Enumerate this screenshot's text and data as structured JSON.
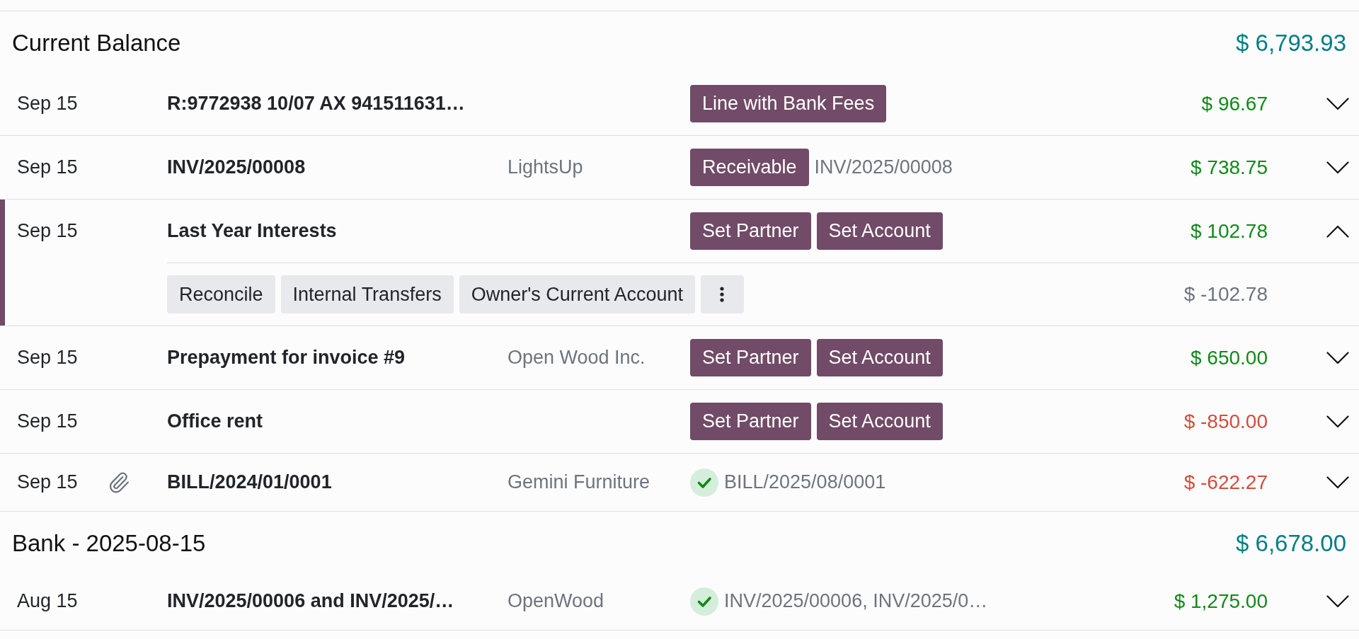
{
  "sections": [
    {
      "title": "Current Balance",
      "balance": "$ 6,793.93",
      "lines": [
        {
          "date": "Sep 15",
          "attachment": false,
          "label": "R:9772938 10/07 AX 941511631…",
          "actions": [
            "Line with Bank Fees"
          ],
          "matched": false,
          "amount": "$ 96.67",
          "color": "#108a17",
          "expanded": false,
          "selected": false
        },
        {
          "date": "Sep 15",
          "attachment": false,
          "label": "INV/2025/00008",
          "partner": "LightsUp",
          "actions": [
            "Receivable"
          ],
          "matched": false,
          "reference": "INV/2025/00008",
          "amount": "$ 738.75",
          "color": "#108a17",
          "expanded": false,
          "selected": false
        },
        {
          "date": "Sep 15",
          "attachment": false,
          "label": "Last Year Interests",
          "actions": [
            "Set Partner",
            "Set Account"
          ],
          "matched": false,
          "amount": "$ 102.78",
          "color": "#108a17",
          "expanded": true,
          "selected": true,
          "detail": {
            "options": [
              "Reconcile",
              "Internal Transfers",
              "Owner's Current Account"
            ],
            "amount": "$ -102.78",
            "color": "#6c757d"
          }
        },
        {
          "date": "Sep 15",
          "attachment": false,
          "label": "Prepayment for invoice #9",
          "partner": "Open Wood Inc.",
          "actions": [
            "Set Partner",
            "Set Account"
          ],
          "matched": false,
          "amount": "$ 650.00",
          "color": "#108a17",
          "expanded": false,
          "selected": false
        },
        {
          "date": "Sep 15",
          "attachment": false,
          "label": "Office rent",
          "actions": [
            "Set Partner",
            "Set Account"
          ],
          "matched": false,
          "amount": "$ -850.00",
          "color": "#d44c3b",
          "expanded": false,
          "selected": false
        },
        {
          "date": "Sep 15",
          "attachment": true,
          "label": "BILL/2024/01/0001",
          "partner": "Gemini Furniture",
          "matched": true,
          "reference": "BILL/2025/08/0001",
          "amount": "$ -622.27",
          "color": "#d44c3b",
          "expanded": false,
          "selected": false
        }
      ]
    },
    {
      "title": "Bank - 2025-08-15",
      "balance": "$ 6,678.00",
      "lines": [
        {
          "date": "Aug 15",
          "attachment": false,
          "label": "INV/2025/00006 and INV/2025/…",
          "partner": "OpenWood",
          "matched": true,
          "reference": "INV/2025/00006, INV/2025/0…",
          "amount": "$ 1,275.00",
          "color": "#108a17",
          "expanded": false,
          "selected": false
        }
      ]
    }
  ]
}
